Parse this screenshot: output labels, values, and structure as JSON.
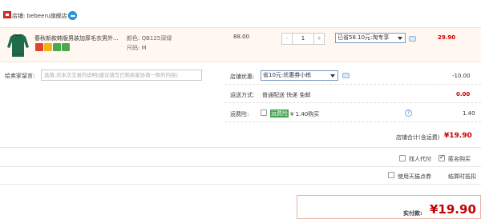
{
  "store": {
    "label": "店铺: bebeeru旗舰店"
  },
  "item": {
    "title": "春秋新款韩版男装加厚毛衣男外...",
    "color_label": "颜色: QB125深绿",
    "size_label": "尺码: M",
    "unit_price": "88.00",
    "quantity": "1",
    "minus": "-",
    "plus": "+",
    "promo_selected": "已省58.10元:淘专享",
    "subtotal": "29.90",
    "service_icon_colors": [
      "#e0442e",
      "#f3b21b",
      "#4aa94e",
      "#4aa94e"
    ]
  },
  "message": {
    "label": "给卖家留言:",
    "placeholder": "选填:对本次交易的说明(建议填写已和卖家协商一致的内容)"
  },
  "store_discount": {
    "label": "店铺优惠:",
    "selected": "省10元:优惠券小栋",
    "amount": "-10.00"
  },
  "shipping": {
    "label": "运送方式:",
    "method": "普通配送 快递 免邮",
    "amount": "0.00"
  },
  "insurance": {
    "label": "运费险:",
    "tag": "运费险",
    "desc": "¥ 1.40购买",
    "amount": "1.40",
    "hint": "?"
  },
  "store_total": {
    "label": "店铺合计(含运费)",
    "amount": "¥19.90"
  },
  "options": {
    "proxy_pay": "找人代付",
    "anonymous": "匿名购买",
    "use_tmall_points": "使用天猫点券",
    "settlement": "结算时抵扣"
  },
  "final": {
    "label": "实付款:",
    "amount": "¥19.90"
  },
  "colors": {
    "accent_red": "#c40000",
    "item_bg": "#fff7f0"
  }
}
